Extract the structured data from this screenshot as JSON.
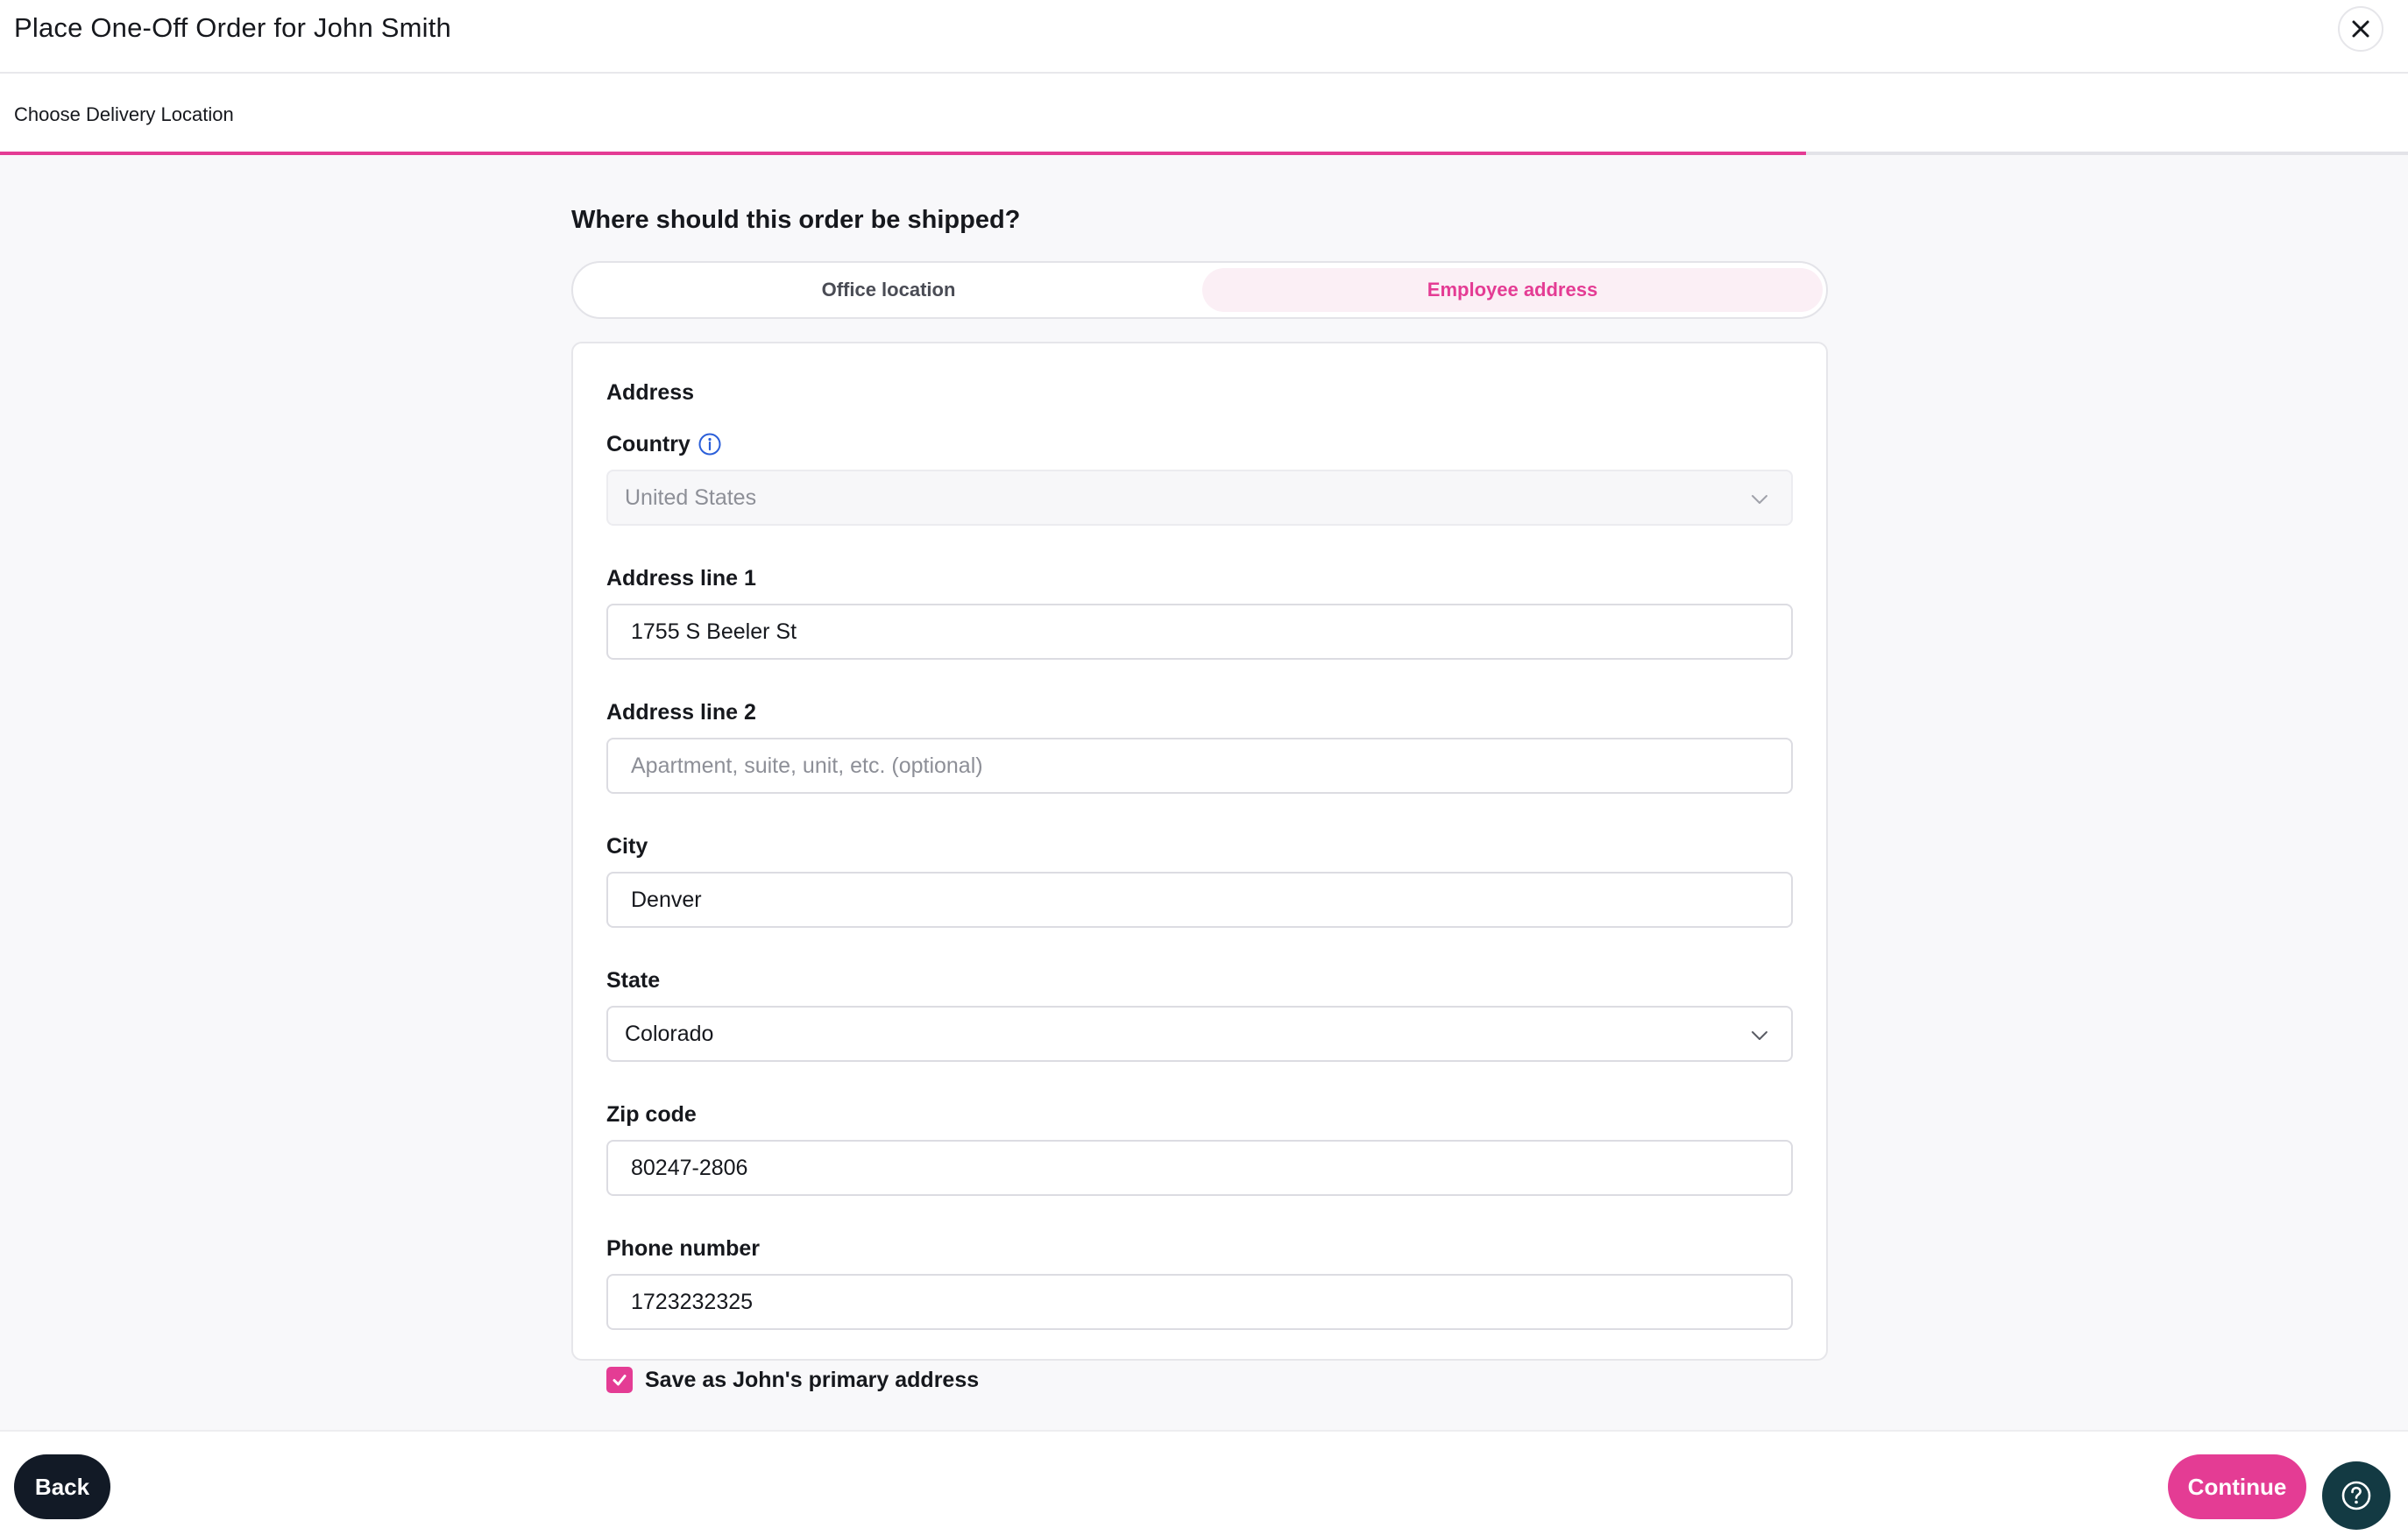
{
  "header": {
    "title": "Place One-Off Order for John Smith",
    "close_icon": "close-icon"
  },
  "stepper": {
    "label": "Choose Delivery Location",
    "progress_percent": 75,
    "accent_color": "#e43c94"
  },
  "shipping": {
    "question": "Where should this order be shipped?",
    "options": [
      "Office location",
      "Employee address"
    ],
    "selected": "Employee address"
  },
  "form": {
    "section_title": "Address",
    "country": {
      "label": "Country",
      "value": "United States",
      "icon": "info-icon"
    },
    "address_line_1": {
      "label": "Address line 1",
      "value": "1755 S Beeler St"
    },
    "address_line_2": {
      "label": "Address line 2",
      "placeholder": "Apartment, suite, unit, etc. (optional)"
    },
    "city": {
      "label": "City",
      "value": "Denver"
    },
    "state": {
      "label": "State",
      "value": "Colorado"
    },
    "zip": {
      "label": "Zip code",
      "value": "80247-2806"
    },
    "phone": {
      "label": "Phone number",
      "value": "1723232325"
    },
    "save_primary": {
      "label": "Save as John's primary address",
      "checked": true
    }
  },
  "footer": {
    "back_label": "Back",
    "continue_label": "Continue",
    "help_icon": "help-icon"
  }
}
